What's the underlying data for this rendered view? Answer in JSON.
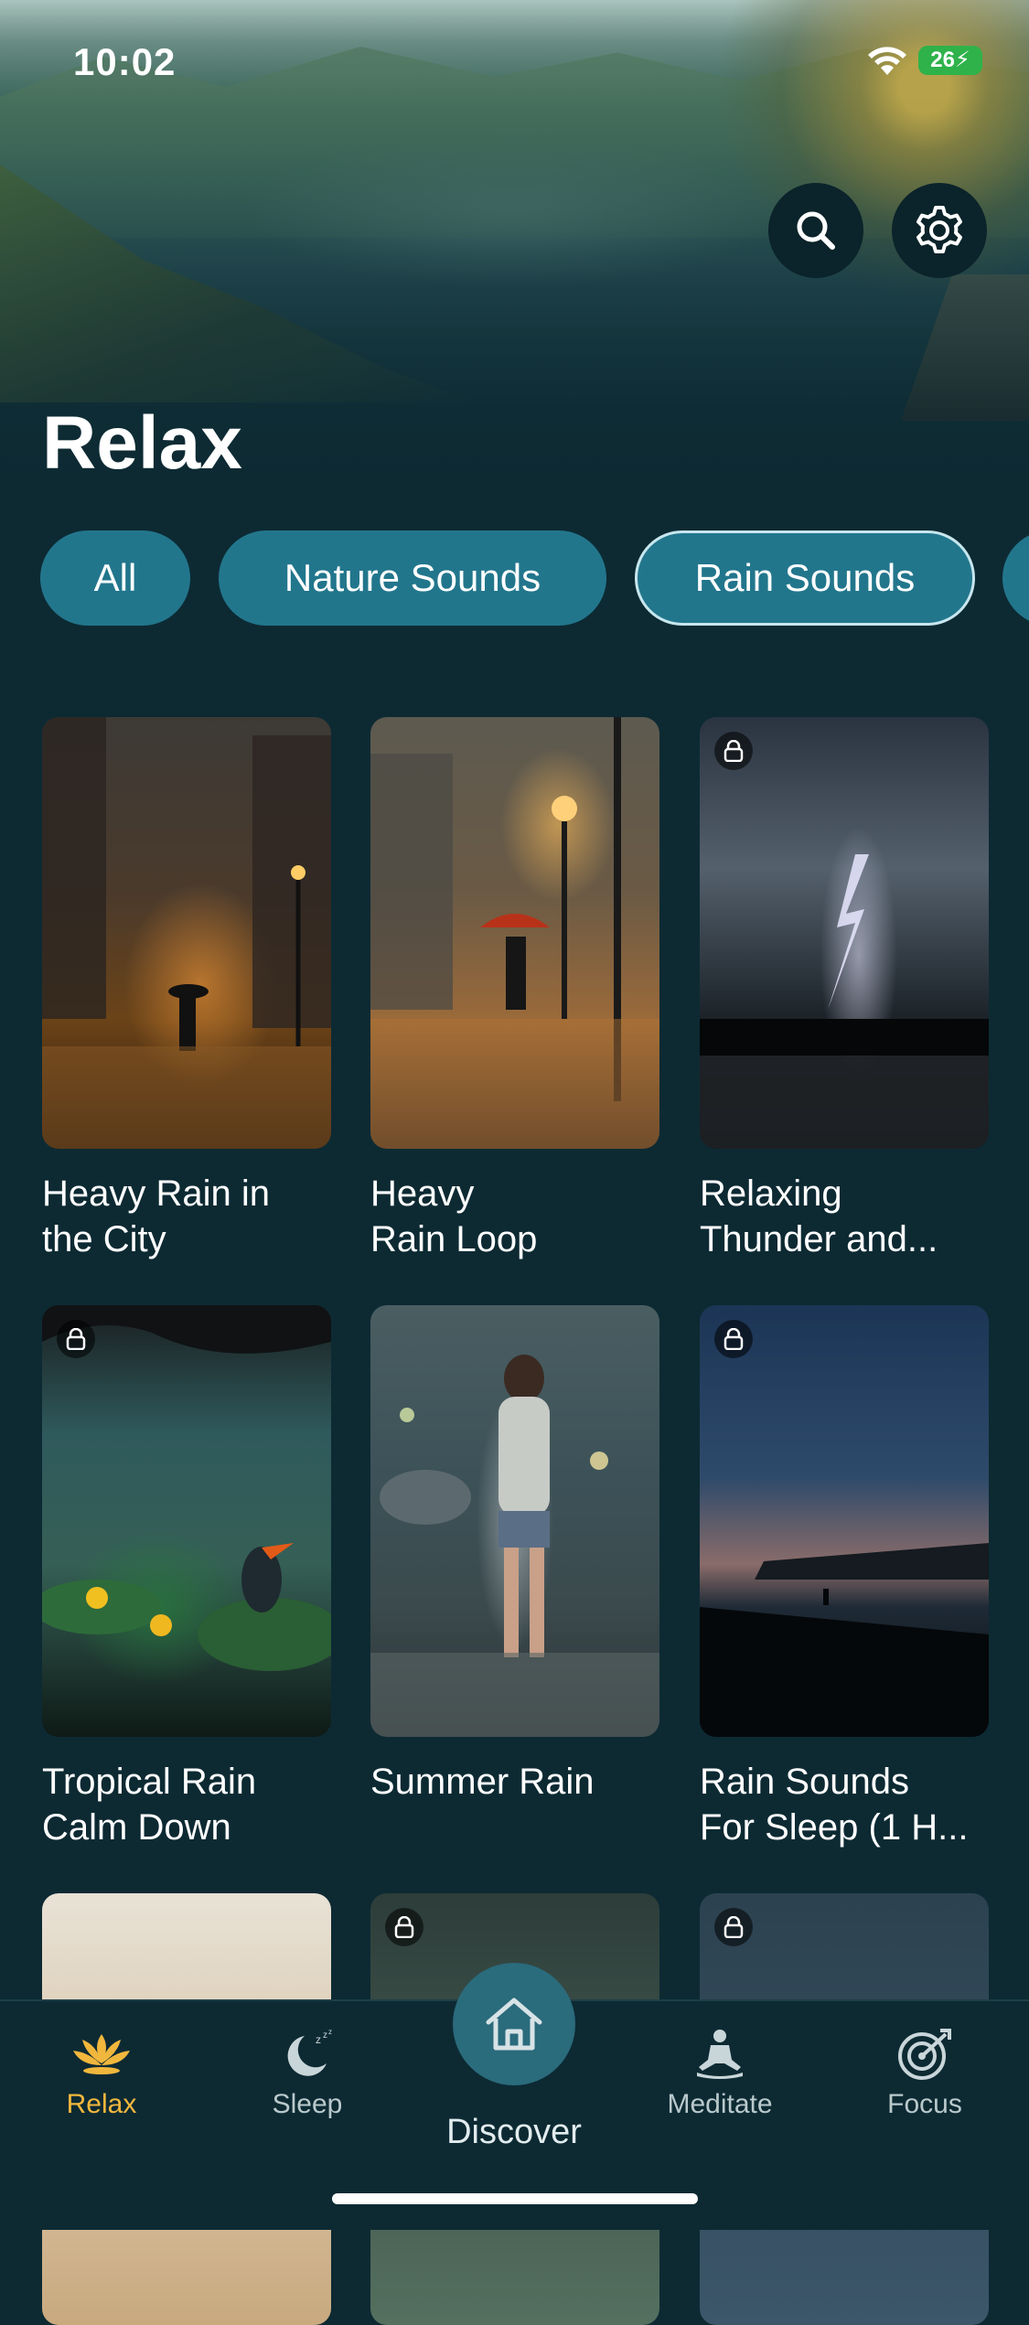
{
  "status_bar": {
    "time": "10:02",
    "battery": "26"
  },
  "page": {
    "title": "Relax"
  },
  "chips": [
    {
      "label": "All",
      "active": false
    },
    {
      "label": "Nature Sounds",
      "active": false
    },
    {
      "label": "Rain Sounds",
      "active": true
    }
  ],
  "cards": [
    {
      "title_line1": "Heavy Rain in",
      "title_line2": "the City",
      "locked": false
    },
    {
      "title_line1": "Heavy",
      "title_line2": "Rain Loop",
      "locked": false
    },
    {
      "title_line1": "Relaxing",
      "title_line2": "Thunder and...",
      "locked": true
    },
    {
      "title_line1": "Tropical Rain",
      "title_line2": "Calm Down",
      "locked": true
    },
    {
      "title_line1": "Summer Rain",
      "title_line2": "",
      "locked": false
    },
    {
      "title_line1": "Rain Sounds",
      "title_line2": "For Sleep (1 H...",
      "locked": true
    }
  ],
  "tabs": {
    "relax": "Relax",
    "sleep": "Sleep",
    "discover": "Discover",
    "meditate": "Meditate",
    "focus": "Focus"
  },
  "colors": {
    "accent": "#f1b73d",
    "background": "#0d2a33",
    "chip": "#22768c"
  }
}
